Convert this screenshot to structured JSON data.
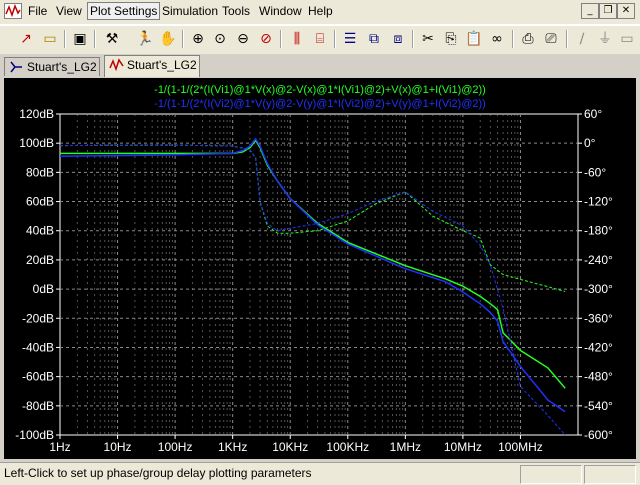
{
  "menu": {
    "file": "File",
    "view": "View",
    "plot_settings": "Plot Settings",
    "simulation": "Simulation",
    "tools": "Tools",
    "window": "Window",
    "help": "Help"
  },
  "tabs": [
    {
      "label": "Stuart's_LG2"
    },
    {
      "label": "Stuart's_LG2"
    }
  ],
  "status": {
    "text": "Left-Click to set up phase/group delay plotting parameters"
  },
  "colors": {
    "trace1": "#22ff22",
    "trace2": "#2030ff",
    "plot_bg": "#000000",
    "axis": "#ffffff",
    "grid": "#8a8a8a"
  },
  "chart_data": {
    "type": "line",
    "title": "",
    "traces": [
      {
        "name": "-1/(1-1/(2*(I(Vi1)@1*V(x)@2-V(x)@1*I(Vi1)@2)+V(x)@1+I(Vi1)@2))",
        "color": "#22ff22"
      },
      {
        "name": "-1/(1-1/(2*(I(Vi2)@1*V(y)@2-V(y)@1*I(Vi2)@2)+V(y)@1+I(Vi2)@2))",
        "color": "#2030ff"
      }
    ],
    "x_scale": "log",
    "x_ticks": [
      "1Hz",
      "10Hz",
      "100Hz",
      "1KHz",
      "10KHz",
      "100KHz",
      "1MHz",
      "10MHz",
      "100MHz"
    ],
    "x_range": [
      1,
      1000000000
    ],
    "y_left_ticks": [
      "120dB",
      "100dB",
      "80dB",
      "60dB",
      "40dB",
      "20dB",
      "0dB",
      "-20dB",
      "-40dB",
      "-60dB",
      "-80dB",
      "-100dB"
    ],
    "y_left_range": [
      -100,
      120
    ],
    "y_right_ticks": [
      "60°",
      "0°",
      "-60°",
      "-120°",
      "-180°",
      "-240°",
      "-300°",
      "-360°",
      "-420°",
      "-480°",
      "-540°",
      "-600°"
    ],
    "y_right_range": [
      -600,
      60
    ],
    "grid": true,
    "series": [
      {
        "name": "trace1 magnitude",
        "unit": "dB",
        "style": "solid",
        "color": "#22ff22",
        "x": [
          1,
          100,
          1000,
          1500,
          2000,
          2500,
          3000,
          4000,
          6000,
          10000,
          30000,
          100000,
          1000000,
          5000000,
          10000000,
          20000000,
          30000000,
          40000000,
          50000000,
          100000000,
          300000000,
          600000000
        ],
        "y": [
          93,
          93,
          93,
          94,
          97,
          102,
          97,
          85,
          74,
          62,
          45,
          32,
          16,
          7,
          2,
          -5,
          -10,
          -14,
          -30,
          -42,
          -54,
          -68
        ]
      },
      {
        "name": "trace2 magnitude",
        "unit": "dB",
        "style": "solid",
        "color": "#2030ff",
        "x": [
          1,
          100,
          1000,
          1500,
          2000,
          2500,
          3000,
          4000,
          6000,
          10000,
          30000,
          100000,
          1000000,
          5000000,
          10000000,
          20000000,
          30000000,
          40000000,
          50000000,
          100000000,
          300000000,
          600000000
        ],
        "y": [
          91,
          92,
          93,
          95,
          98,
          103,
          98,
          86,
          74,
          62,
          44,
          31,
          14,
          5,
          -2,
          -10,
          -16,
          -22,
          -36,
          -53,
          -76,
          -84
        ]
      },
      {
        "name": "trace1 phase",
        "unit": "deg",
        "style": "dashed",
        "color": "#22ff22",
        "x": [
          1,
          100,
          1000,
          1500,
          2000,
          2500,
          3000,
          4000,
          6000,
          10000,
          30000,
          100000,
          300000,
          1000000,
          3000000,
          10000000,
          20000000,
          30000000,
          50000000,
          100000000,
          300000000,
          600000000
        ],
        "y": [
          -5,
          -4,
          -6,
          -10,
          -14,
          -30,
          -120,
          -170,
          -185,
          -185,
          -180,
          -160,
          -125,
          -100,
          -150,
          -180,
          -195,
          -250,
          -270,
          -280,
          -295,
          -305
        ]
      },
      {
        "name": "trace2 phase",
        "unit": "deg",
        "style": "dashed",
        "color": "#2030ff",
        "x": [
          1,
          100,
          1000,
          1500,
          2000,
          2500,
          3000,
          4000,
          6000,
          10000,
          30000,
          100000,
          300000,
          1000000,
          3000000,
          10000000,
          20000000,
          30000000,
          50000000,
          100000000,
          300000000,
          600000000
        ],
        "y": [
          -5,
          -4,
          -6,
          -10,
          -14,
          -30,
          -120,
          -165,
          -180,
          -175,
          -165,
          -145,
          -120,
          -100,
          -140,
          -170,
          -210,
          -250,
          -340,
          -500,
          -560,
          -600
        ]
      }
    ]
  }
}
